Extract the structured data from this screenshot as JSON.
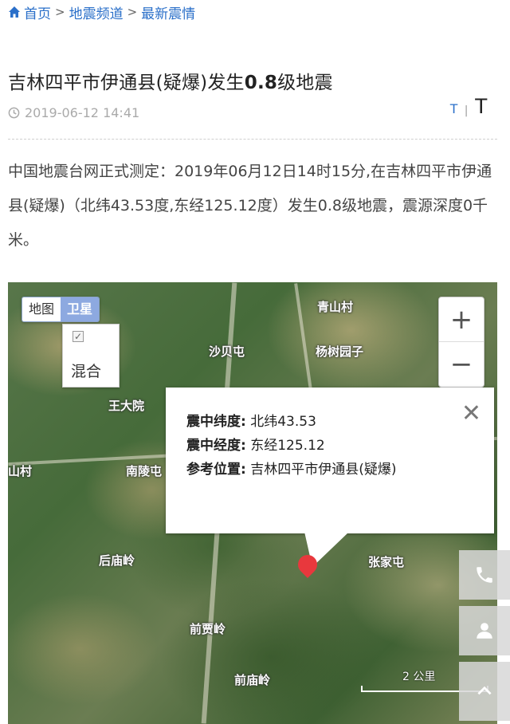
{
  "breadcrumb": {
    "home": "首页",
    "sep1": ">",
    "channel": "地震频道",
    "sep2": ">",
    "latest": "最新震情"
  },
  "article": {
    "title_pre": "吉林四平市伊通县(疑爆)发生",
    "title_mag": "0.8",
    "title_post": "级地震",
    "datetime": "2019-06-12 14:41",
    "font_small": "T",
    "font_sep": "|",
    "font_large": "T",
    "body": "中国地震台网正式测定：2019年06月12日14时15分,在吉林四平市伊通县(疑爆)（北纬43.53度,东经125.12度）发生0.8级地震，震源深度0千米。"
  },
  "map": {
    "type_map": "地图",
    "type_satellite": "卫星",
    "hybrid_label": "混合",
    "zoom_in": "+",
    "zoom_out": "−",
    "places": [
      "青山村",
      "沙贝屯",
      "杨树园子",
      "王大院",
      "南陵屯",
      "后庙岭",
      "张家屯",
      "前贾岭",
      "前庙岭",
      "山村"
    ],
    "scale": "2 公里",
    "info": {
      "lat_label": "震中纬度:",
      "lat_value": "北纬43.53",
      "lon_label": "震中经度:",
      "lon_value": "东经125.12",
      "loc_label": "参考位置:",
      "loc_value": "吉林四平市伊通县(疑爆)"
    },
    "icons": [
      "close-icon",
      "map-marker-icon",
      "phone-icon",
      "user-icon",
      "back-to-top-icon"
    ]
  },
  "colors": {
    "link": "#2a6fc9",
    "marker": "#e8383d",
    "satellite_active": "#8da9e0"
  }
}
